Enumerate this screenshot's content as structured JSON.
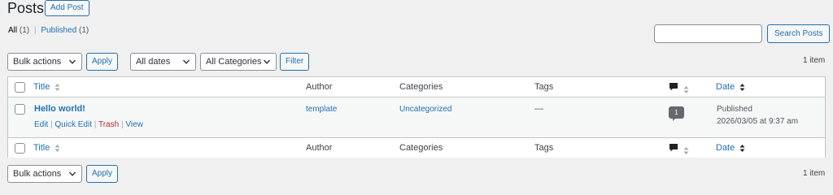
{
  "header": {
    "title": "Posts",
    "add_new_label": "Add Post"
  },
  "views": {
    "all_label": "All",
    "all_count": "(1)",
    "separator": "|",
    "published_label": "Published",
    "published_count": "(1)"
  },
  "search": {
    "value": "",
    "button_label": "Search Posts"
  },
  "toolbar_top": {
    "bulk_actions": "Bulk actions",
    "apply_label": "Apply",
    "dates_filter": "All dates",
    "categories_filter": "All Categories",
    "filter_label": "Filter",
    "items_count": "1 item"
  },
  "table": {
    "columns": {
      "title": "Title",
      "author": "Author",
      "categories": "Categories",
      "tags": "Tags",
      "comments_icon": "comment-bubble-icon",
      "date": "Date"
    },
    "rows": [
      {
        "title": "Hello world!",
        "actions": {
          "edit": "Edit",
          "quick_edit": "Quick Edit",
          "trash": "Trash",
          "view": "View",
          "separator": "|"
        },
        "author": "template",
        "categories": "Uncategorized",
        "tags": "—",
        "comments": "1",
        "status": "Published",
        "datetime": "2026/03/05 at 9:37 am"
      }
    ]
  },
  "toolbar_bottom": {
    "bulk_actions": "Bulk actions",
    "apply_label": "Apply",
    "items_count": "1 item"
  },
  "colors": {
    "link": "#2271b1",
    "trash": "#b32d2e",
    "background": "#f0f0f1",
    "border": "#c3c4c7"
  }
}
